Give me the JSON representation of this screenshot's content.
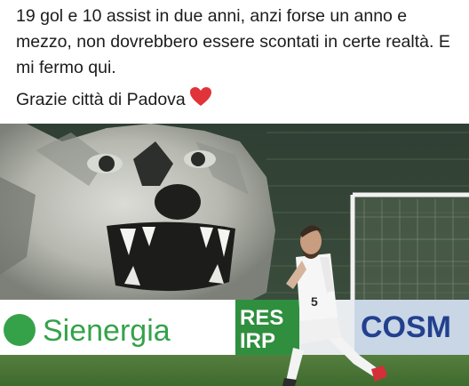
{
  "post": {
    "paragraph1": "19 gol e 10 assist in due anni, anzi forse un anno e mezzo, non dovrebbero essere scontati in certe realtà. E mi fermo qui.",
    "paragraph2": "Grazie città di Padova",
    "emoji": "red-heart-icon"
  },
  "photo": {
    "banner_left": "Sienergia",
    "banner_middle_line1": "RES",
    "banner_middle_line2": "IRP",
    "banner_right": "COSM",
    "shirt_number": "5"
  },
  "colors": {
    "text": "#1c1c1e",
    "heart": "#e0333a",
    "banner_green": "#35a24a",
    "pitch": "#4f7a3a"
  }
}
